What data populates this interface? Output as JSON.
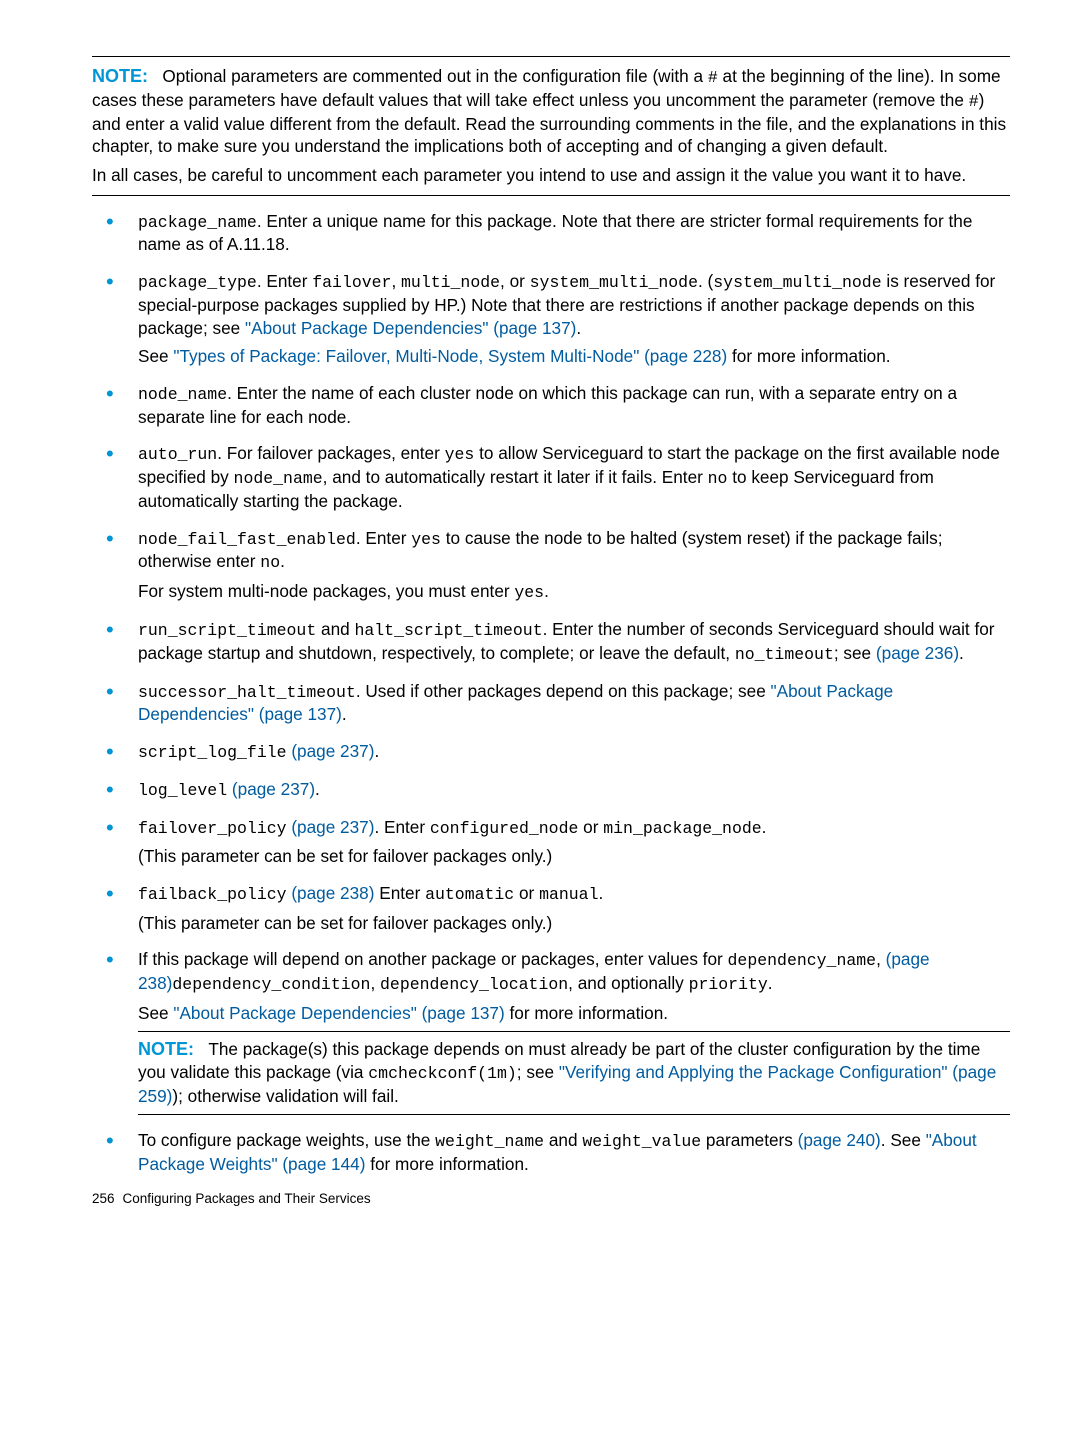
{
  "note": {
    "label": "NOTE:",
    "para1a": "Optional parameters are commented out in the configuration file (with a ",
    "hash1": "#",
    "para1b": " at the beginning of the line). In some cases these parameters have default values that will take effect unless you uncomment the parameter (remove the ",
    "hash2": "#",
    "para1c": ") and enter a valid value different from the default. Read the surrounding comments in the file, and the explanations in this chapter, to make sure you understand the implications both of accepting and of changing a given default.",
    "para2": "In all cases, be careful to uncomment each parameter you intend to use and assign it the value you want it to have."
  },
  "items": {
    "i1": {
      "c1": "package_name",
      "t1": ". Enter a unique name for this package. Note that there are stricter formal requirements for the name as of A.11.18."
    },
    "i2": {
      "c1": "package_type",
      "t1": ". Enter ",
      "c2": "failover",
      "t2": ", ",
      "c3": "multi_node",
      "t3": ", or ",
      "c4": "system_multi_node",
      "t4": ". (",
      "c5": "system_multi_node",
      "t5": " is reserved for special-purpose packages supplied by HP.) Note that there are restrictions if another package depends on this package; see ",
      "l1": "\"About Package Dependencies\" (page 137)",
      "t6": ".",
      "p2a": "See ",
      "l2": "\"Types of Package: Failover, Multi-Node, System Multi-Node\" (page 228)",
      "p2b": " for more information."
    },
    "i3": {
      "c1": "node_name",
      "t1": ". Enter the name of each cluster node on which this package can run, with a separate entry on a separate line for each node."
    },
    "i4": {
      "c1": "auto_run",
      "t1": ". For failover packages, enter ",
      "c2": "yes",
      "t2": " to allow Serviceguard to start the package on the first available node specified by ",
      "c3": "node_name",
      "t3": ", and to automatically restart it later if it fails. Enter ",
      "c4": "no",
      "t4": " to keep Serviceguard from automatically starting the package."
    },
    "i5": {
      "c1": "node_fail_fast_enabled",
      "t1": ". Enter ",
      "c2": "yes",
      "t2": " to cause the node to be halted (system reset) if the package fails; otherwise enter ",
      "c3": "no",
      "t3": ".",
      "p2a": "For system multi-node packages, you must enter ",
      "c4": "yes",
      "p2b": "."
    },
    "i6": {
      "c1": "run_script_timeout",
      "t1": " and ",
      "c2": "halt_script_timeout",
      "t2": ". Enter the number of seconds Serviceguard should wait for package startup and shutdown, respectively, to complete; or leave the default, ",
      "c3": "no_timeout",
      "t3": "; see ",
      "l1": "(page 236)",
      "t4": "."
    },
    "i7": {
      "c1": "successor_halt_timeout",
      "t1": ". Used if other packages depend on this package; see ",
      "l1": "\"About Package Dependencies\" (page 137)",
      "t2": "."
    },
    "i8": {
      "c1": "script_log_file",
      "sp": " ",
      "l1": "(page 237)",
      "t1": "."
    },
    "i9": {
      "c1": "log_level",
      "sp": " ",
      "l1": "(page 237)",
      "t1": "."
    },
    "i10": {
      "c1": "failover_policy",
      "sp": " ",
      "l1": "(page 237)",
      "t1": ". Enter ",
      "c2": "configured_node",
      "t2": " or ",
      "c3": "min_package_node",
      "t3": ".",
      "p2": "(This parameter can be set for failover packages only.)"
    },
    "i11": {
      "c1": "failback_policy",
      "sp": " ",
      "l1": "(page 238)",
      "t1": " Enter ",
      "c2": "automatic",
      "t2": " or ",
      "c3": "manual",
      "t3": ".",
      "p2": "(This parameter can be set for failover packages only.)"
    },
    "i12": {
      "t0": "If this package will depend on another package or packages, enter values for ",
      "c1": "dependency_name",
      "t1": ", ",
      "l1": "(page 238)",
      "c2": "dependency_condition",
      "t2": ", ",
      "c3": "dependency_location",
      "t3": ", and optionally ",
      "c4": "priority",
      "t4": ".",
      "p2a": "See ",
      "l2": "\"About Package Dependencies\" (page 137)",
      "p2b": " for more information.",
      "note": {
        "label": "NOTE:",
        "t1": "The package(s) this package depends on must already be part of the cluster configuration by the time you validate this package (via ",
        "c1": "cmcheckconf(1m)",
        "t2": "; see ",
        "l1": "\"Verifying and Applying the Package Configuration\" (page 259)",
        "t3": "); otherwise validation will fail."
      }
    },
    "i13": {
      "t0": "To configure package weights, use the ",
      "c1": "weight_name",
      "t1": " and ",
      "c2": "weight_value",
      "t2": " parameters ",
      "l1": "(page 240)",
      "t3": ". See ",
      "l2": "\"About Package Weights\" (page 144)",
      "t4": " for more information."
    }
  },
  "footer": {
    "num": "256",
    "title": "Configuring Packages and Their Services"
  }
}
